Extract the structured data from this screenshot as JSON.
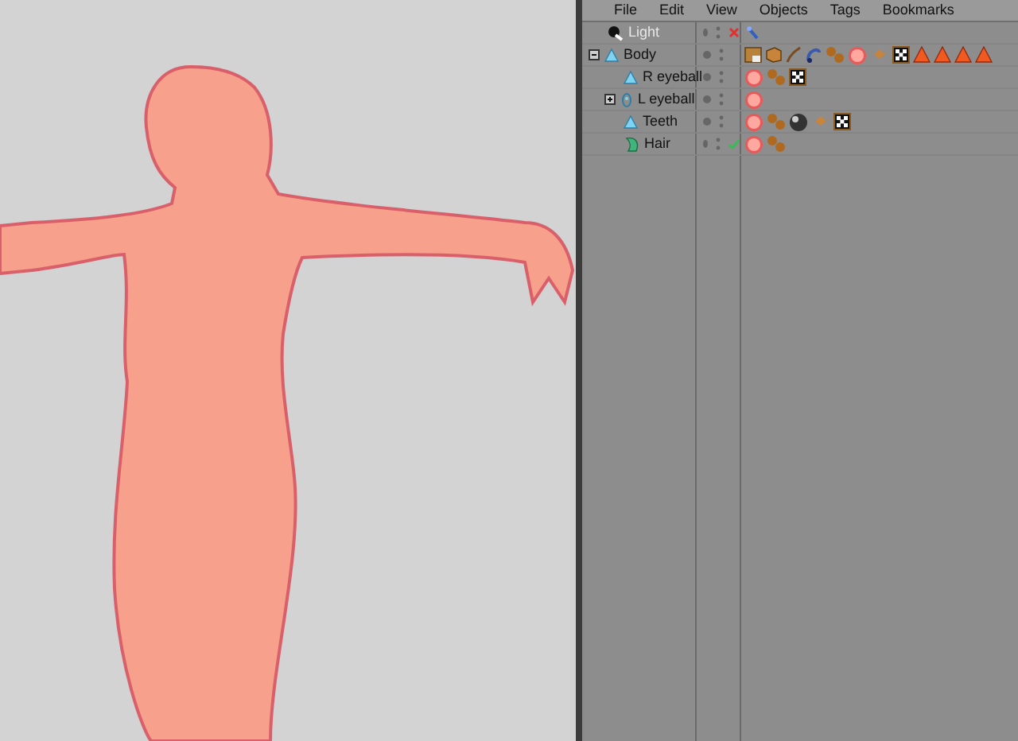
{
  "menu": [
    "File",
    "Edit",
    "View",
    "Objects",
    "Tags",
    "Bookmarks"
  ],
  "objects": [
    {
      "name": "Light",
      "kind": "light",
      "enabled": false,
      "render_enabled": false,
      "tags": [
        {
          "kind": "pin"
        }
      ]
    },
    {
      "name": "Body",
      "kind": "polygon",
      "enabled": true,
      "expanded": true,
      "tags": [
        {
          "kind": "box"
        },
        {
          "kind": "cube"
        },
        {
          "kind": "curve"
        },
        {
          "kind": "hose"
        },
        {
          "kind": "balls"
        },
        {
          "kind": "material"
        },
        {
          "kind": "wings"
        },
        {
          "kind": "checker"
        },
        {
          "kind": "cone"
        },
        {
          "kind": "cone"
        },
        {
          "kind": "cone"
        },
        {
          "kind": "cone"
        }
      ],
      "children": [
        {
          "name": "R eyeball",
          "kind": "polygon",
          "enabled": true,
          "tags": [
            {
              "kind": "material"
            },
            {
              "kind": "balls"
            },
            {
              "kind": "checker"
            }
          ]
        },
        {
          "name": "L eyeball",
          "kind": "eyeball",
          "enabled": true,
          "expanded": false,
          "tags": [
            {
              "kind": "material"
            }
          ]
        },
        {
          "name": "Teeth",
          "kind": "polygon",
          "enabled": true,
          "tags": [
            {
              "kind": "material"
            },
            {
              "kind": "balls"
            },
            {
              "kind": "sphere"
            },
            {
              "kind": "wings"
            },
            {
              "kind": "checker"
            }
          ]
        },
        {
          "name": "Hair",
          "kind": "hair",
          "enabled": true,
          "render_enabled": true,
          "tags": [
            {
              "kind": "material"
            },
            {
              "kind": "balls"
            }
          ]
        }
      ]
    }
  ]
}
